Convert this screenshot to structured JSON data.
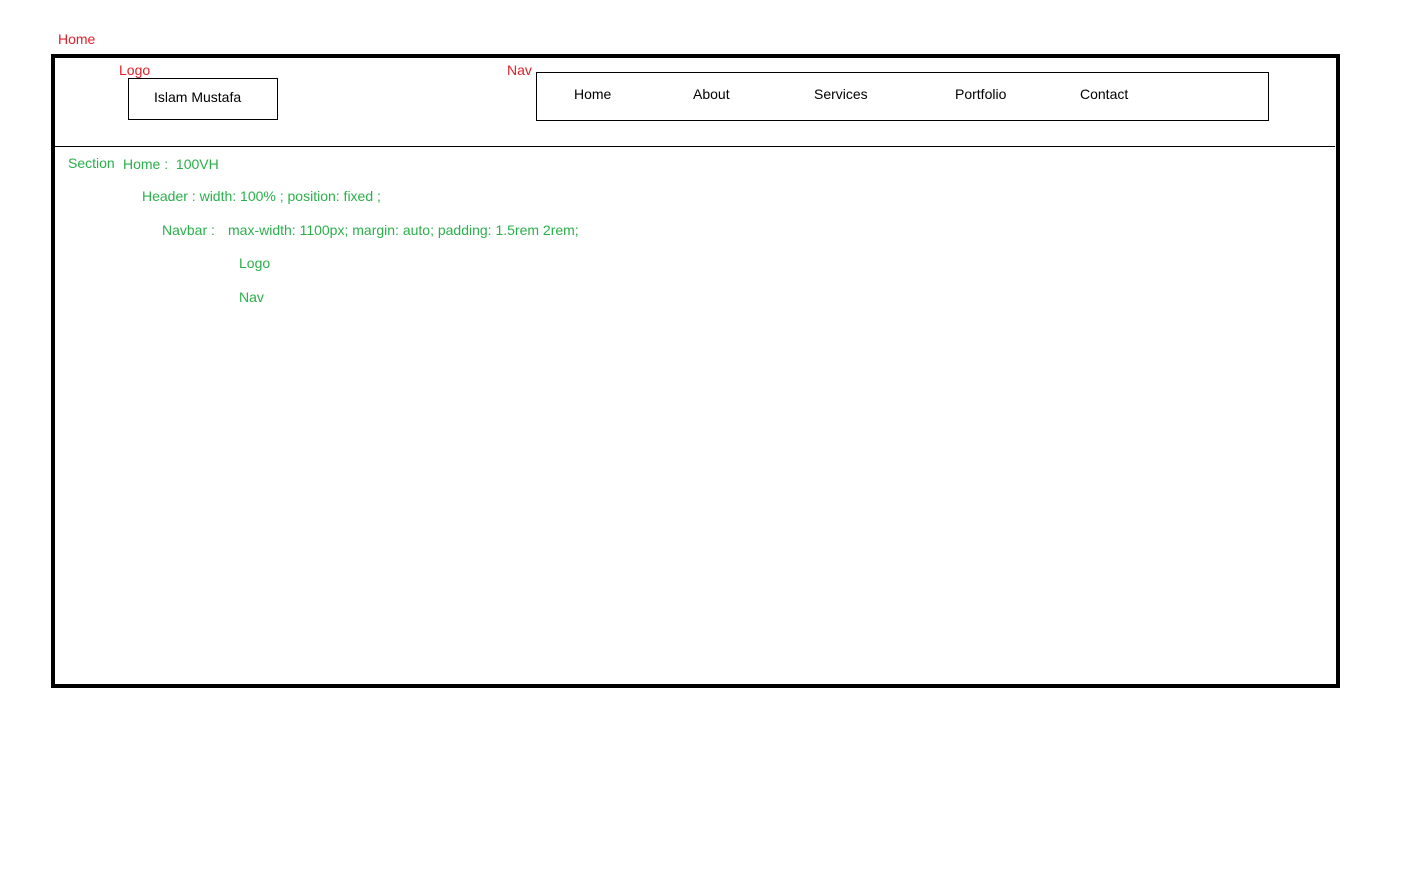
{
  "annotations": {
    "home": "Home",
    "logo": "Logo",
    "nav": "Nav"
  },
  "logo": {
    "text": "Islam Mustafa"
  },
  "nav": {
    "items": [
      "Home",
      "About",
      "Services",
      "Portfolio",
      "Contact"
    ]
  },
  "notes": {
    "section": "Section",
    "home_height": "Home :  100VH",
    "header": "Header : width: 100% ; position: fixed ;",
    "navbar_label": "Navbar :",
    "navbar_rules": "max-width: 1100px; margin: auto; padding: 1.5rem 2rem;",
    "logo": "Logo",
    "nav": "Nav"
  },
  "colors": {
    "annotation_red": "#e0202a",
    "note_green": "#2ab04a",
    "border": "#000000"
  }
}
